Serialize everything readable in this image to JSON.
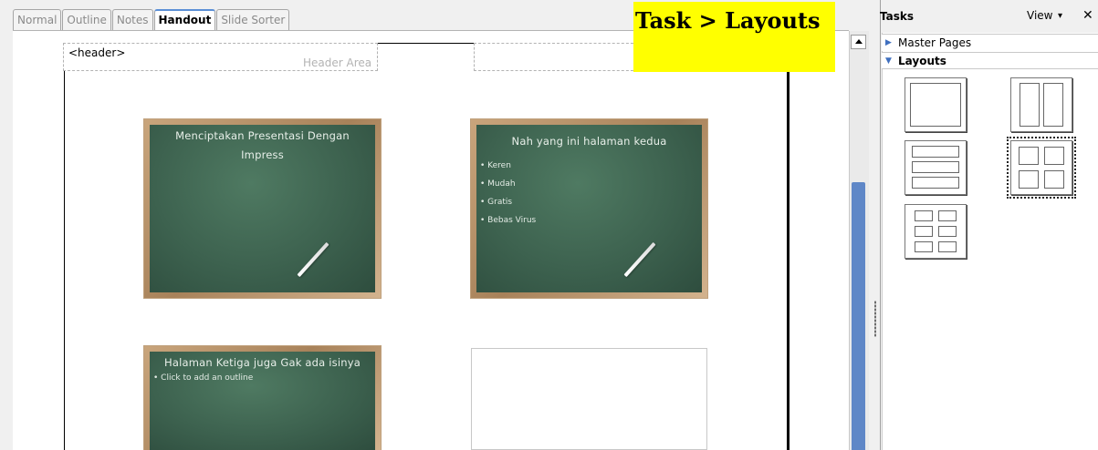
{
  "tabs": [
    "Normal",
    "Outline",
    "Notes",
    "Handout",
    "Slide Sorter"
  ],
  "active_tab": "Handout",
  "header": {
    "placeholder": "<header>",
    "area_label": "Header Area"
  },
  "overlay_label": "Task > Layouts",
  "slides": [
    {
      "title": "Menciptakan Presentasi Dengan Impress",
      "bullets": []
    },
    {
      "title": "Nah yang ini halaman kedua",
      "bullets": [
        "Keren",
        "Mudah",
        "Gratis",
        "Bebas Virus"
      ]
    },
    {
      "title": "Halaman Ketiga juga Gak ada isinya",
      "bullets": [
        "Click to add an outline"
      ]
    }
  ],
  "task_pane": {
    "title": "Tasks",
    "view_label": "View",
    "view_arrow": "▾",
    "close": "✕",
    "sections": {
      "master_pages": "Master Pages",
      "layouts": "Layouts"
    },
    "layouts": [
      "one-slide",
      "two-slides",
      "three-slides",
      "four-slides",
      "six-slides"
    ],
    "selected_layout": "four-slides"
  },
  "scroll": {
    "up_arrow": "▲"
  }
}
